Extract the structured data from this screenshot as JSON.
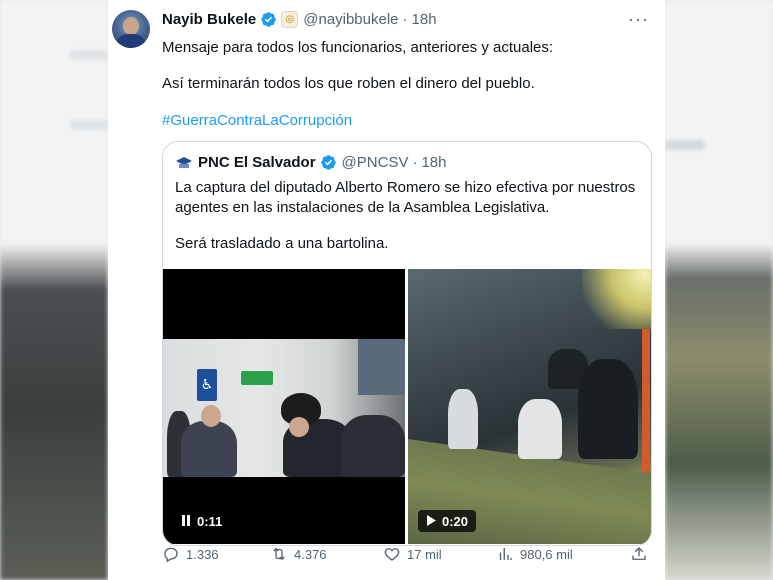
{
  "tweet": {
    "author_name": "Nayib Bukele",
    "handle": "@nayibbukele",
    "time": "18h",
    "separator": "·",
    "text_line1": "Mensaje para todos los funcionarios, anteriores y actuales:",
    "text_line2": "Así terminarán todos los que roben el dinero del pueblo.",
    "hashtag": "#GuerraContraLaCorrupción",
    "more_label": "···"
  },
  "quoted": {
    "author_name": "PNC El Salvador",
    "handle": "@PNCSV",
    "time": "18h",
    "separator": "·",
    "text_line1": "La captura del diputado Alberto Romero se hizo efectiva por nuestros",
    "text_line2": "agentes en las instalaciones de la Asamblea Legislativa.",
    "text_line3": "Será trasladado a una bartolina.",
    "media": [
      {
        "duration": "0:11",
        "state": "paused"
      },
      {
        "duration": "0:20",
        "state": "play"
      }
    ]
  },
  "actions": {
    "replies": "1.336",
    "reposts": "4.376",
    "likes": "17 mil",
    "views": "980,6 mil"
  },
  "colors": {
    "link": "#1d9bf0",
    "verified": "#1d9bf0",
    "secondary_text": "#536471"
  }
}
